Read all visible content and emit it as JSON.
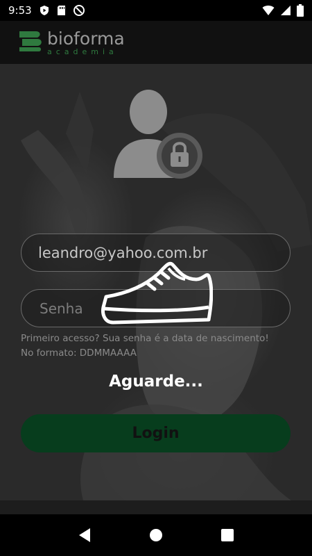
{
  "status_bar": {
    "time": "9:53",
    "icons": [
      "play-protect-icon",
      "sd-card-icon",
      "data-saver-icon",
      "wifi-icon",
      "signal-icon",
      "battery-icon"
    ]
  },
  "app_bar": {
    "logo_name": "bioforma",
    "logo_subtitle": "academia"
  },
  "login_form": {
    "email_value": "leandro@yahoo.com.br",
    "password_placeholder": "Senha",
    "hint": "Primeiro acesso? Sua senha é a data de nascimento! No formato: DDMMAAAA",
    "loading_text": "Aguarde...",
    "login_label": "Login"
  },
  "colors": {
    "brand_green": "#2f7a3f",
    "button_green": "#073d1d",
    "background": "#1c1c1c"
  },
  "nav_bar": {
    "icons": [
      "back-icon",
      "home-icon",
      "recents-icon"
    ]
  }
}
